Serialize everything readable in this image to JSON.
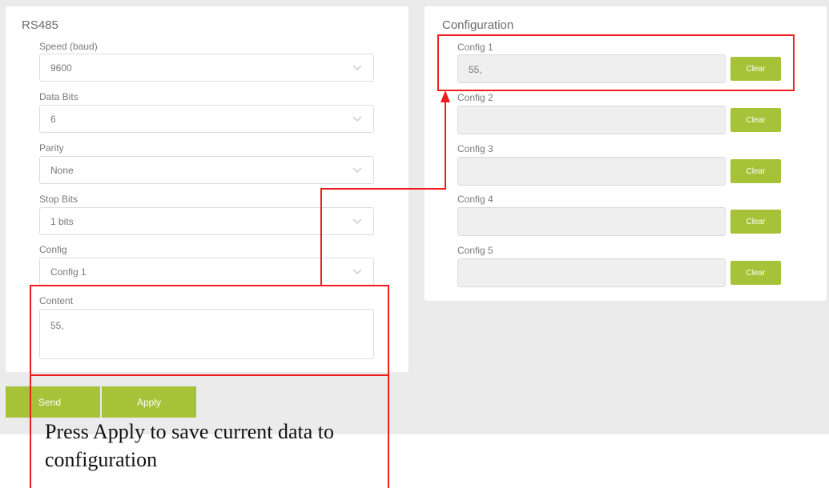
{
  "left_panel": {
    "title": "RS485",
    "speed": {
      "label": "Speed (baud)",
      "value": "9600"
    },
    "data_bits": {
      "label": "Data Bits",
      "value": "6"
    },
    "parity": {
      "label": "Parity",
      "value": "None"
    },
    "stop_bits": {
      "label": "Stop Bits",
      "value": "1 bits"
    },
    "config": {
      "label": "Config",
      "value": "Config 1"
    },
    "content": {
      "label": "Content",
      "value": "55,"
    }
  },
  "right_panel": {
    "title": "Configuration",
    "configs": [
      {
        "label": "Config 1",
        "value": "55,",
        "clear_label": "Clear"
      },
      {
        "label": "Config 2",
        "value": "",
        "clear_label": "Clear"
      },
      {
        "label": "Config 3",
        "value": "",
        "clear_label": "Clear"
      },
      {
        "label": "Config 4",
        "value": "",
        "clear_label": "Clear"
      },
      {
        "label": "Config 5",
        "value": "",
        "clear_label": "Clear"
      }
    ]
  },
  "actions": {
    "send_label": "Send",
    "apply_label": "Apply"
  },
  "annotation": {
    "text": "Press Apply to save current data to configuration"
  },
  "colors": {
    "accent_green": "#a5c239",
    "annotation_red": "#ee1c1c",
    "background_gray": "#ebebeb"
  }
}
